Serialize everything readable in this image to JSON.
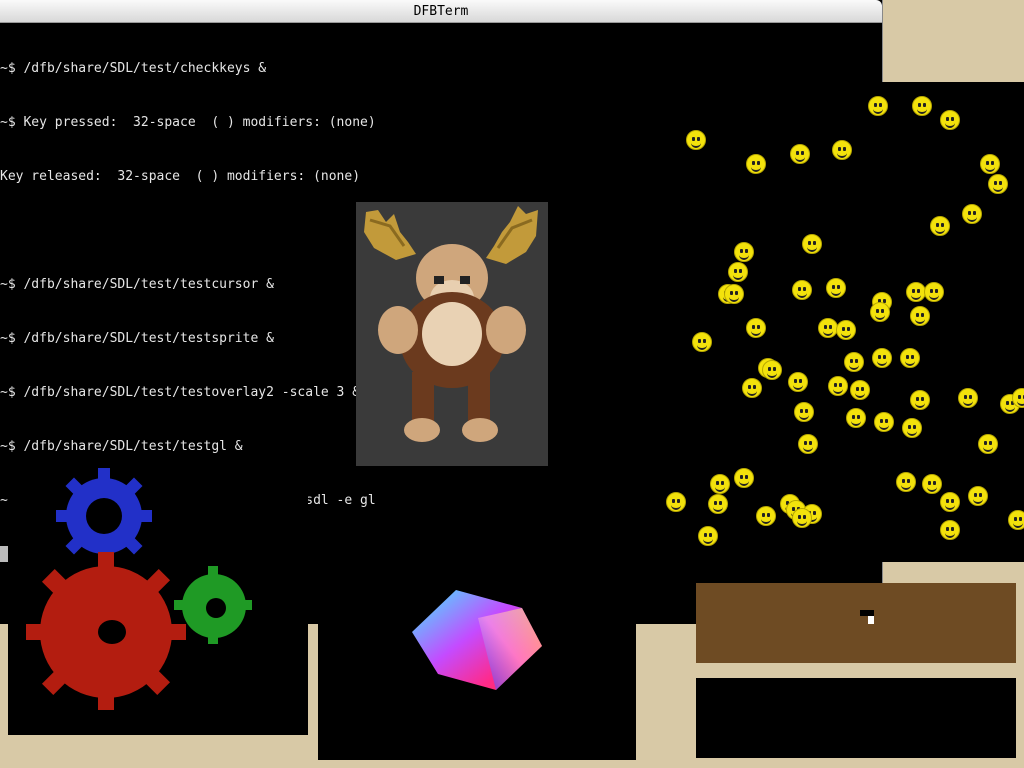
{
  "window": {
    "title": "DFBTerm"
  },
  "terminal": {
    "lines": [
      "~$ /dfb/share/SDL/test/checkkeys &",
      "~$ Key pressed:  32-space  ( ) modifiers: (none)",
      "Key released:  32-space  ( ) modifiers: (none)",
      "",
      "~$ /dfb/share/SDL/test/testcursor &",
      "~$ /dfb/share/SDL/test/testsprite &",
      "~$ /dfb/share/SDL/test/testoverlay2 -scale 3 &",
      "~$ /dfb/share/SDL/test/testgl &",
      "~$ WIDTH=300 HEIGHT=300 yagears-gui -t sdl -e gl"
    ]
  },
  "colors": {
    "desktop": "#d8c9a6",
    "terminal_bg": "#000000",
    "terminal_fg": "#e6e6e6",
    "smiley": "#f3e20c",
    "cursor_window": "#6e4b23",
    "gear_red": "#b31d10",
    "gear_green": "#1f9a25",
    "gear_blue": "#2230c8"
  },
  "icons": {
    "moose": "moose-sprite",
    "smiley": "smiley-sprite",
    "gears": "gears-render",
    "cube": "color-cube-render"
  }
}
